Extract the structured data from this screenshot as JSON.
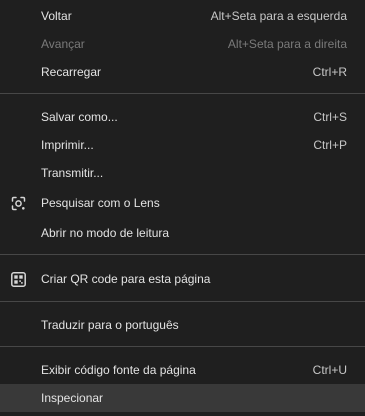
{
  "menu": {
    "items": [
      {
        "label": "Voltar",
        "shortcut": "Alt+Seta para a esquerda"
      },
      {
        "label": "Avançar",
        "shortcut": "Alt+Seta para a direita"
      },
      {
        "label": "Recarregar",
        "shortcut": "Ctrl+R"
      },
      {
        "label": "Salvar como...",
        "shortcut": "Ctrl+S"
      },
      {
        "label": "Imprimir...",
        "shortcut": "Ctrl+P"
      },
      {
        "label": "Transmitir..."
      },
      {
        "label": "Pesquisar com o Lens",
        "icon": "lens-icon"
      },
      {
        "label": "Abrir no modo de leitura"
      },
      {
        "label": "Criar QR code para esta página",
        "icon": "qr-code-icon"
      },
      {
        "label": "Traduzir para o português"
      },
      {
        "label": "Exibir código fonte da página",
        "shortcut": "Ctrl+U"
      },
      {
        "label": "Inspecionar"
      }
    ]
  },
  "colors": {
    "background": "#1f1f1f",
    "text": "#e3e3e3",
    "disabled_text": "#7a7a7a",
    "separator": "#474747",
    "highlight": "#393939"
  }
}
